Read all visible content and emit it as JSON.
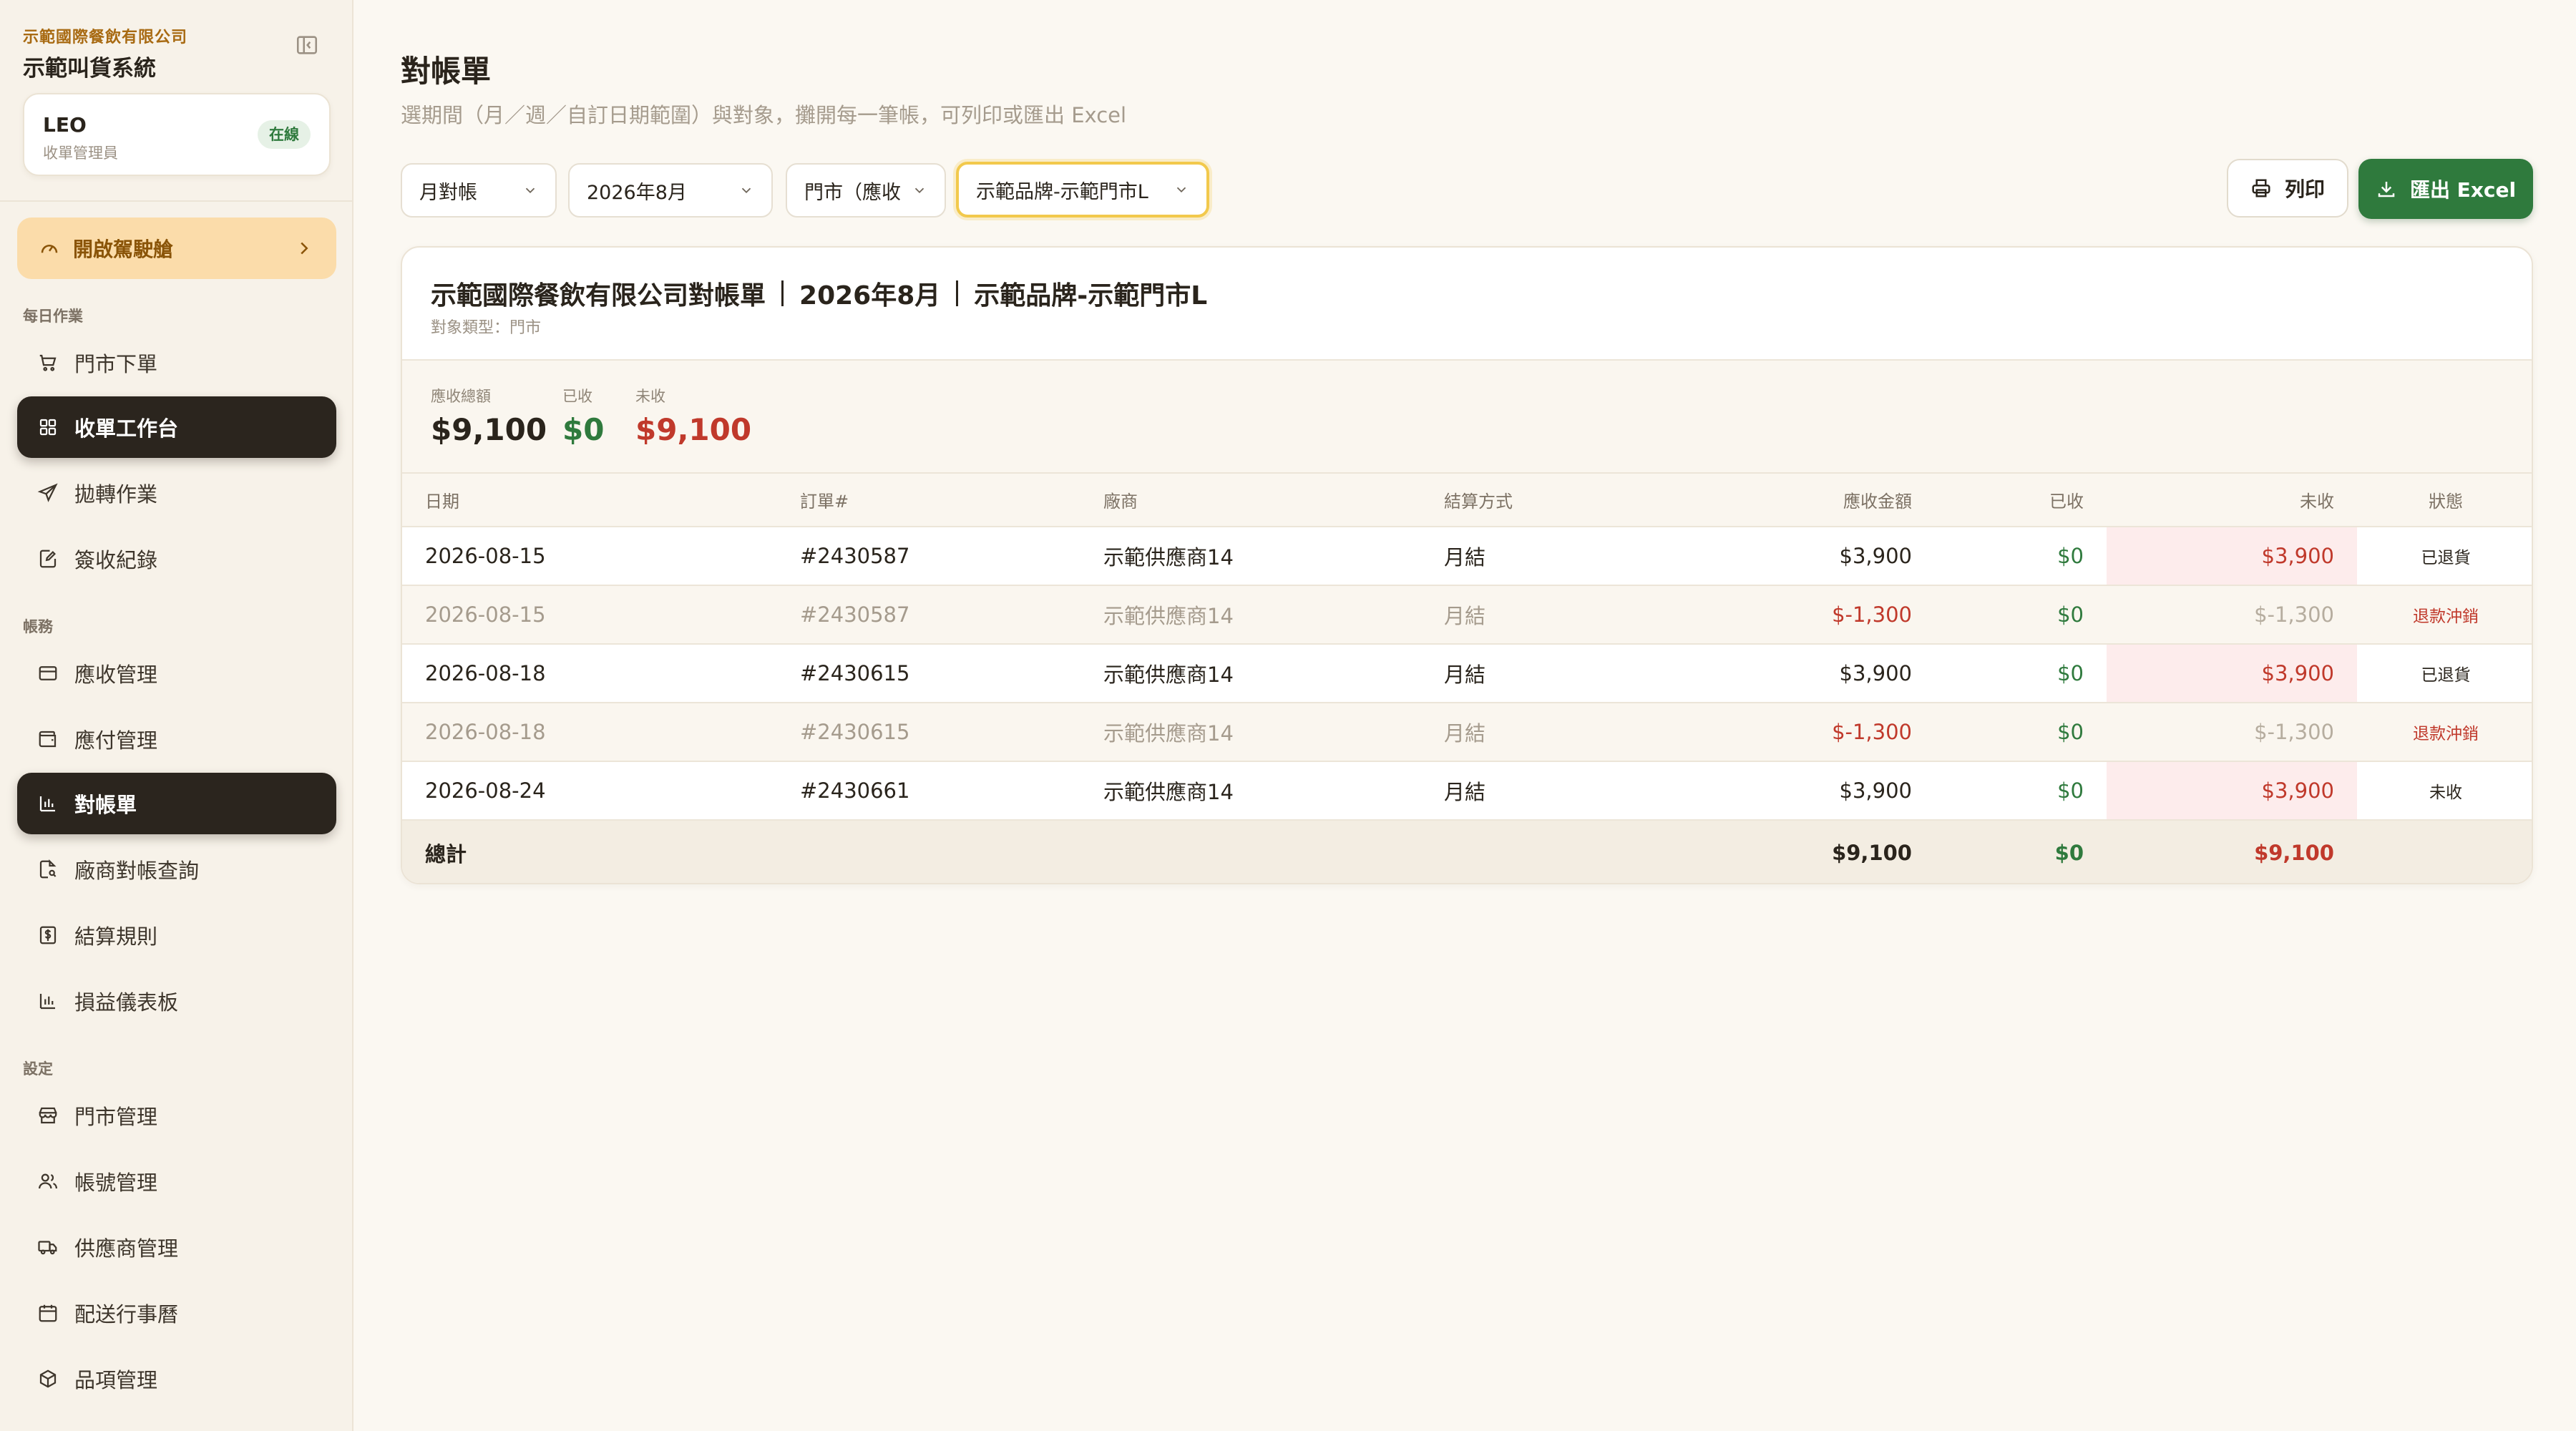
{
  "sidebar": {
    "company": "示範國際餐飲有限公司",
    "system": "示範叫貨系統",
    "user": {
      "name": "LEO",
      "role": "收單管理員",
      "status": "在線"
    },
    "driver_button": "開啟駕駛艙",
    "sections": {
      "daily": "每日作業",
      "accounts": "帳務",
      "settings": "設定"
    },
    "items": [
      {
        "label": "門市下單",
        "icon": "cart-icon"
      },
      {
        "label": "收單工作台",
        "icon": "grid-icon"
      },
      {
        "label": "拋轉作業",
        "icon": "send-icon"
      },
      {
        "label": "簽收紀錄",
        "icon": "edit-note-icon"
      },
      {
        "label": "應收管理",
        "icon": "card-icon"
      },
      {
        "label": "應付管理",
        "icon": "wallet-icon"
      },
      {
        "label": "對帳單",
        "icon": "bar-chart-icon"
      },
      {
        "label": "廠商對帳查詢",
        "icon": "file-search-icon"
      },
      {
        "label": "結算規則",
        "icon": "dollar-doc-icon"
      },
      {
        "label": "損益儀表板",
        "icon": "bar-chart-icon"
      },
      {
        "label": "門市管理",
        "icon": "store-icon"
      },
      {
        "label": "帳號管理",
        "icon": "users-icon"
      },
      {
        "label": "供應商管理",
        "icon": "truck-icon"
      },
      {
        "label": "配送行事曆",
        "icon": "calendar-icon"
      },
      {
        "label": "品項管理",
        "icon": "box-icon"
      }
    ]
  },
  "page": {
    "title": "對帳單",
    "subtitle": "選期間（月／週／自訂日期範圍）與對象，攤開每一筆帳，可列印或匯出 Excel"
  },
  "filters": {
    "period_type": "月對帳",
    "month": "2026年8月",
    "target_type": "門市（應收）",
    "target": "示範品牌-示範門市L"
  },
  "actions": {
    "print": "列印",
    "export": "匯出 Excel"
  },
  "statement": {
    "title_company": "示範國際餐飲有限公司對帳單",
    "title_period": "2026年8月",
    "title_target": "示範品牌-示範門市L",
    "target_type_line": "對象類型：門市",
    "summary": {
      "receivable_label": "應收總額",
      "receivable": "$9,100",
      "received_label": "已收",
      "received": "$0",
      "unpaid_label": "未收",
      "unpaid": "$9,100"
    },
    "columns": [
      "日期",
      "訂單#",
      "廠商",
      "結算方式",
      "應收金額",
      "已收",
      "未收",
      "狀態"
    ],
    "rows": [
      {
        "date": "2026-08-15",
        "order": "#2430587",
        "vendor": "示範供應商14",
        "method": "月結",
        "amount": "$3,900",
        "received": "$0",
        "unpaid": "$3,900",
        "status": "已退貨",
        "refund": false
      },
      {
        "date": "2026-08-15",
        "order": "#2430587",
        "vendor": "示範供應商14",
        "method": "月結",
        "amount": "$-1,300",
        "received": "$0",
        "unpaid": "$-1,300",
        "status": "退款沖銷",
        "refund": true
      },
      {
        "date": "2026-08-18",
        "order": "#2430615",
        "vendor": "示範供應商14",
        "method": "月結",
        "amount": "$3,900",
        "received": "$0",
        "unpaid": "$3,900",
        "status": "已退貨",
        "refund": false
      },
      {
        "date": "2026-08-18",
        "order": "#2430615",
        "vendor": "示範供應商14",
        "method": "月結",
        "amount": "$-1,300",
        "received": "$0",
        "unpaid": "$-1,300",
        "status": "退款沖銷",
        "refund": true
      },
      {
        "date": "2026-08-24",
        "order": "#2430661",
        "vendor": "示範供應商14",
        "method": "月結",
        "amount": "$3,900",
        "received": "$0",
        "unpaid": "$3,900",
        "status": "未收",
        "refund": false
      }
    ],
    "total": {
      "label": "總計",
      "amount": "$9,100",
      "received": "$0",
      "unpaid": "$9,100"
    }
  },
  "colors": {
    "accent_green": "#2f7a3d",
    "accent_red": "#c0392b",
    "brand_amber": "#a86a12",
    "active_nav": "#2b251e"
  }
}
